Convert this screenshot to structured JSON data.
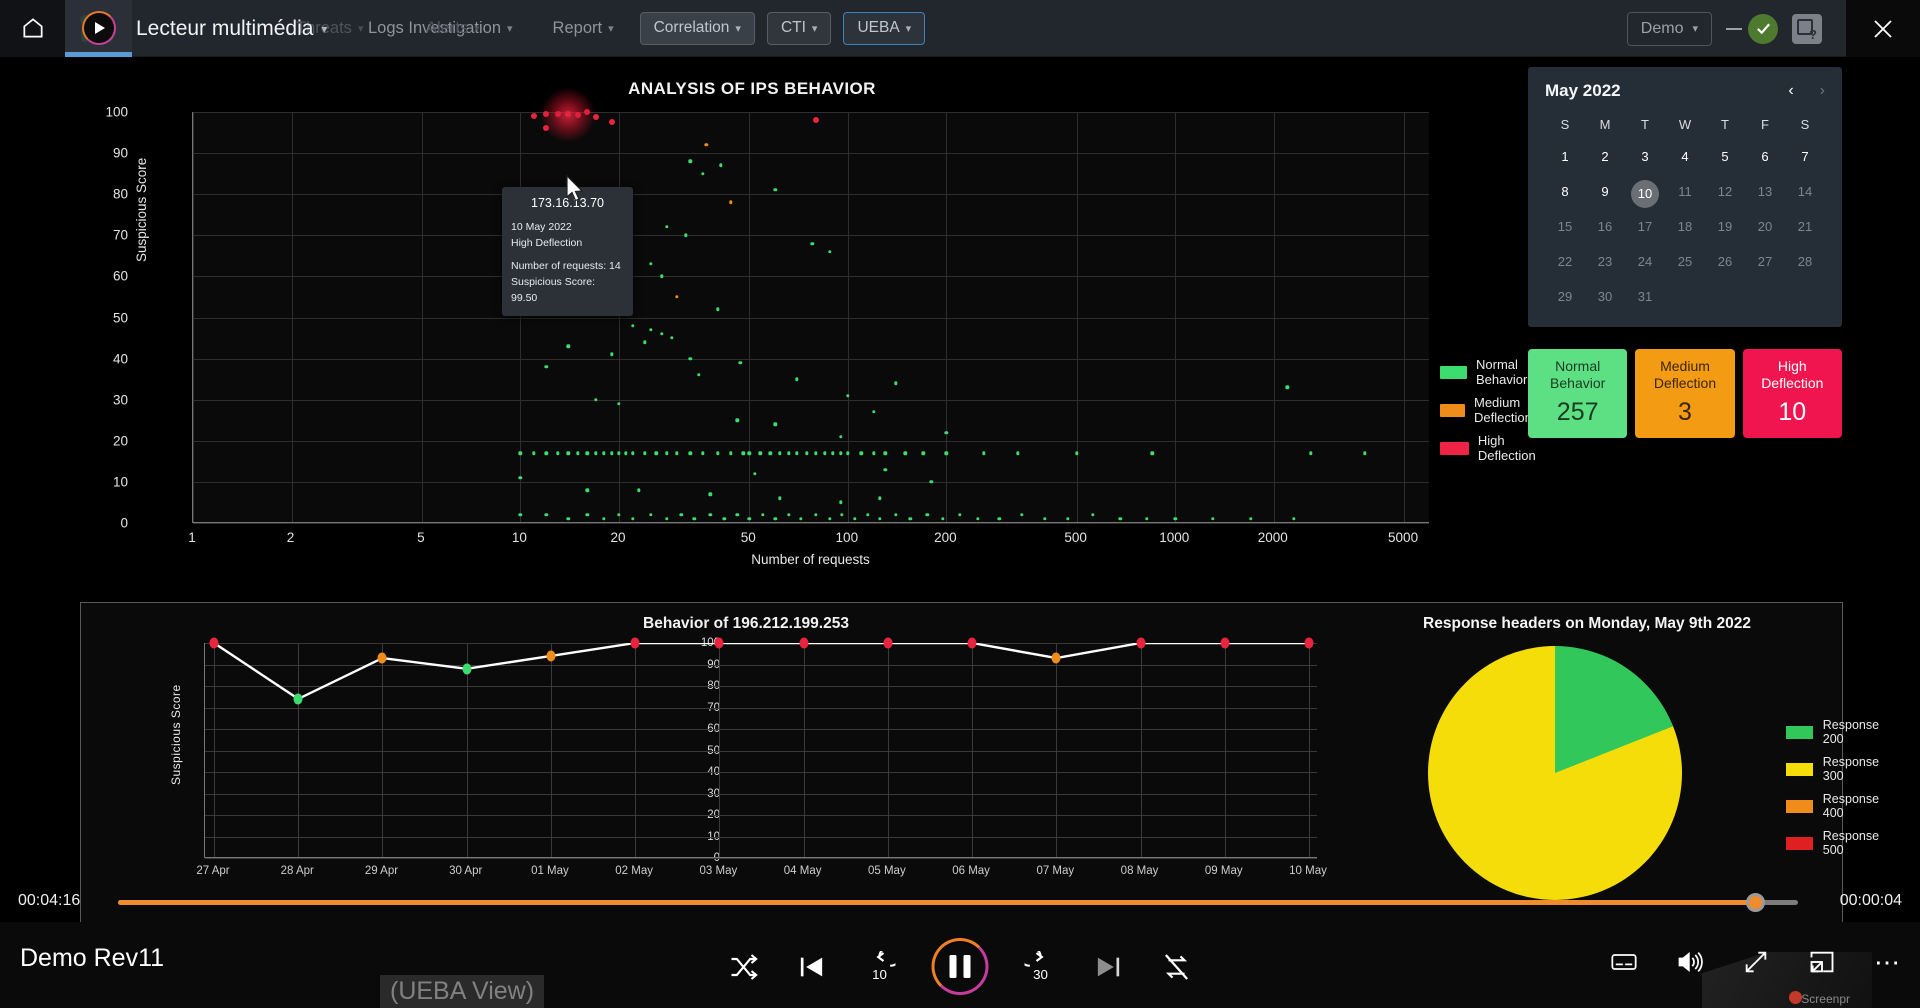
{
  "topnav": {
    "home_icon": "home-icon",
    "logo_icon": "play-logo-icon",
    "ghost_items": [
      "Threats",
      "Alerts"
    ],
    "items": [
      {
        "label": "Logs Investigation",
        "style": "plain-link"
      },
      {
        "label": "Report",
        "style": "plain-link"
      },
      {
        "label": "Correlation",
        "style": "boxed"
      },
      {
        "label": "CTI",
        "style": "boxed-plain"
      },
      {
        "label": "UEBA",
        "style": "boxed-active"
      }
    ],
    "player_title": "Lecteur multimédia",
    "account": "Demo",
    "status_icon": "check-circle-icon",
    "help_icon": "help-window-icon",
    "close_icon": "close-icon"
  },
  "scatter": {
    "title": "ANALYSIS OF IPS BEHAVIOR",
    "legend": [
      {
        "label": "Normal Behavior",
        "color": "#3ddc6e"
      },
      {
        "label": "Medium Deflection",
        "color": "#f08c1a"
      },
      {
        "label": "High Deflection",
        "color": "#e8243f"
      }
    ],
    "tooltip": {
      "ip": "173.16.13.70",
      "date": "10 May 2022",
      "classification": "High Deflection",
      "requests": "Number of requests: 14",
      "score": "Suspicious Score: 99.50"
    }
  },
  "calendar": {
    "title": "May 2022",
    "prev_icon": "chevron-left-icon",
    "next_icon": "chevron-right-icon",
    "dow": [
      "S",
      "M",
      "T",
      "W",
      "T",
      "F",
      "S"
    ],
    "selected_day": 10,
    "last_enabled_day": 10,
    "days": [
      1,
      2,
      3,
      4,
      5,
      6,
      7,
      8,
      9,
      10,
      11,
      12,
      13,
      14,
      15,
      16,
      17,
      18,
      19,
      20,
      21,
      22,
      23,
      24,
      25,
      26,
      27,
      28,
      29,
      30,
      31
    ]
  },
  "cards": [
    {
      "label": "Normal Behavior",
      "value": "257",
      "bg": "#5ce083",
      "fg": "#1b3a22"
    },
    {
      "label": "Medium Deflection",
      "value": "3",
      "bg": "#f29b13",
      "fg": "#3a2505"
    },
    {
      "label": "High Deflection",
      "value": "10",
      "bg": "#f0154e",
      "fg": "#ffffff"
    }
  ],
  "player": {
    "time_elapsed": "00:04:16",
    "time_remaining": "00:00:04",
    "video_title": "Demo Rev11",
    "overlay_badge": "(UEBA View)",
    "watermark": "Screenpr",
    "controls": [
      {
        "name": "shuffle-button",
        "icon": "shuffle-icon"
      },
      {
        "name": "previous-button",
        "icon": "skip-previous-icon"
      },
      {
        "name": "rewind-10-button",
        "icon": "rewind-10-icon",
        "label": "10"
      },
      {
        "name": "pause-button",
        "icon": "pause-icon"
      },
      {
        "name": "forward-30-button",
        "icon": "forward-30-icon",
        "label": "30"
      },
      {
        "name": "next-button",
        "icon": "skip-next-icon"
      },
      {
        "name": "repeat-off-button",
        "icon": "repeat-off-icon"
      }
    ],
    "right_controls": [
      {
        "name": "subtitles-button",
        "icon": "subtitles-icon"
      },
      {
        "name": "volume-button",
        "icon": "volume-high-icon"
      },
      {
        "name": "fullscreen-button",
        "icon": "fullscreen-icon"
      },
      {
        "name": "picture-in-picture-button",
        "icon": "pip-icon"
      },
      {
        "name": "more-options-button",
        "icon": "ellipsis-icon"
      }
    ]
  },
  "chart_data": [
    {
      "type": "scatter",
      "title": "ANALYSIS OF IPS BEHAVIOR",
      "xlabel": "Number of requests",
      "ylabel": "Suspicious Score",
      "xscale": "log",
      "xticks": [
        1,
        2,
        5,
        10,
        20,
        50,
        100,
        200,
        500,
        1000,
        2000,
        5000
      ],
      "yticks": [
        0,
        10,
        20,
        30,
        40,
        50,
        60,
        70,
        80,
        90,
        100
      ],
      "ylim": [
        0,
        100
      ],
      "grid": true,
      "legend_position": "right",
      "series": [
        {
          "name": "High Deflection",
          "color": "#e8243f",
          "points": [
            [
              12,
              99.5
            ],
            [
              13,
              99.5
            ],
            [
              14,
              99.5
            ],
            [
              15,
              99.2
            ],
            [
              11,
              99.0
            ],
            [
              17,
              98.8
            ],
            [
              19,
              97.5
            ],
            [
              80,
              98.0
            ],
            [
              12,
              96.0
            ],
            [
              16,
              100
            ]
          ]
        },
        {
          "name": "Medium Deflection",
          "color": "#f08c1a",
          "points": [
            [
              37,
              92.0
            ],
            [
              44,
              78.0
            ],
            [
              30,
              55.0
            ]
          ]
        },
        {
          "name": "Normal Behavior",
          "color": "#3ddc6e",
          "points": [
            [
              33,
              88
            ],
            [
              41,
              87
            ],
            [
              36,
              85
            ],
            [
              60,
              81
            ],
            [
              28,
              72
            ],
            [
              32,
              70
            ],
            [
              78,
              68
            ],
            [
              88,
              66
            ],
            [
              25,
              63
            ],
            [
              27,
              60
            ],
            [
              17,
              57
            ],
            [
              18,
              55
            ],
            [
              20,
              53
            ],
            [
              40,
              52
            ],
            [
              22,
              48
            ],
            [
              25,
              47
            ],
            [
              27,
              46
            ],
            [
              29,
              45
            ],
            [
              24,
              44
            ],
            [
              14,
              43
            ],
            [
              19,
              41
            ],
            [
              33,
              40
            ],
            [
              47,
              39
            ],
            [
              12,
              38
            ],
            [
              35,
              36
            ],
            [
              70,
              35
            ],
            [
              140,
              34
            ],
            [
              2200,
              33
            ],
            [
              100,
              31
            ],
            [
              17,
              30
            ],
            [
              20,
              29
            ],
            [
              120,
              27
            ],
            [
              46,
              25
            ],
            [
              60,
              24
            ],
            [
              200,
              22
            ],
            [
              95,
              21
            ],
            [
              10,
              17
            ],
            [
              11,
              17
            ],
            [
              12,
              17
            ],
            [
              13,
              17
            ],
            [
              14,
              17
            ],
            [
              15,
              17
            ],
            [
              16,
              17
            ],
            [
              17,
              17
            ],
            [
              18,
              17
            ],
            [
              19,
              17
            ],
            [
              20,
              17
            ],
            [
              21,
              17
            ],
            [
              22,
              17
            ],
            [
              24,
              17
            ],
            [
              26,
              17
            ],
            [
              28,
              17
            ],
            [
              30,
              17
            ],
            [
              33,
              17
            ],
            [
              36,
              17
            ],
            [
              40,
              17
            ],
            [
              44,
              17
            ],
            [
              48,
              17
            ],
            [
              50,
              17
            ],
            [
              54,
              17
            ],
            [
              58,
              17
            ],
            [
              62,
              17
            ],
            [
              66,
              17
            ],
            [
              70,
              17
            ],
            [
              75,
              17
            ],
            [
              80,
              17
            ],
            [
              85,
              17
            ],
            [
              90,
              17
            ],
            [
              95,
              17
            ],
            [
              100,
              17
            ],
            [
              110,
              17
            ],
            [
              120,
              17
            ],
            [
              130,
              17
            ],
            [
              150,
              17
            ],
            [
              170,
              17
            ],
            [
              200,
              17
            ],
            [
              260,
              17
            ],
            [
              330,
              17
            ],
            [
              500,
              17
            ],
            [
              850,
              17
            ],
            [
              2600,
              17
            ],
            [
              3800,
              17
            ],
            [
              10,
              11
            ],
            [
              52,
              12
            ],
            [
              130,
              13
            ],
            [
              180,
              10
            ],
            [
              16,
              8
            ],
            [
              23,
              8
            ],
            [
              38,
              7
            ],
            [
              62,
              6
            ],
            [
              95,
              5
            ],
            [
              125,
              6
            ],
            [
              10,
              2
            ],
            [
              12,
              2
            ],
            [
              14,
              1
            ],
            [
              16,
              2
            ],
            [
              18,
              1
            ],
            [
              20,
              2
            ],
            [
              22,
              1
            ],
            [
              25,
              2
            ],
            [
              28,
              1
            ],
            [
              31,
              2
            ],
            [
              34,
              1
            ],
            [
              38,
              2
            ],
            [
              42,
              1
            ],
            [
              46,
              2
            ],
            [
              50,
              1
            ],
            [
              55,
              2
            ],
            [
              60,
              1
            ],
            [
              66,
              2
            ],
            [
              72,
              1
            ],
            [
              80,
              2
            ],
            [
              88,
              1
            ],
            [
              96,
              2
            ],
            [
              105,
              1
            ],
            [
              115,
              2
            ],
            [
              125,
              1
            ],
            [
              140,
              2
            ],
            [
              155,
              1
            ],
            [
              175,
              2
            ],
            [
              195,
              1
            ],
            [
              220,
              2
            ],
            [
              250,
              1
            ],
            [
              290,
              1
            ],
            [
              340,
              2
            ],
            [
              400,
              1
            ],
            [
              470,
              1
            ],
            [
              560,
              2
            ],
            [
              680,
              1
            ],
            [
              820,
              1
            ],
            [
              1000,
              1
            ],
            [
              1300,
              1
            ],
            [
              1700,
              1
            ],
            [
              2300,
              1
            ]
          ]
        }
      ]
    },
    {
      "type": "line",
      "title": "Behavior of 196.212.199.253",
      "xlabel": "",
      "ylabel": "Suspicious Score",
      "categories": [
        "27 Apr",
        "28 Apr",
        "29 Apr",
        "30 Apr",
        "01 May",
        "02 May",
        "03 May",
        "04 May",
        "05 May",
        "06 May",
        "07 May",
        "08 May",
        "09 May",
        "10 May"
      ],
      "yticks": [
        0,
        10,
        20,
        30,
        40,
        50,
        60,
        70,
        80,
        90,
        100
      ],
      "ylim": [
        0,
        100
      ],
      "grid": true,
      "line_color": "#ffffff",
      "values": [
        100,
        74,
        93,
        88,
        94,
        100,
        100,
        100,
        100,
        100,
        93,
        100,
        100,
        100
      ],
      "point_colors": [
        "#e8243f",
        "#3ddc6e",
        "#f08c1a",
        "#3ddc6e",
        "#f08c1a",
        "#e8243f",
        "#e8243f",
        "#e8243f",
        "#e8243f",
        "#e8243f",
        "#f08c1a",
        "#e8243f",
        "#e8243f",
        "#e8243f"
      ]
    },
    {
      "type": "pie",
      "title": "Response headers on Monday, May 9th 2022",
      "labels": [
        "Response 200",
        "Response 300",
        "Response 400",
        "Response 500"
      ],
      "values": [
        19,
        81,
        0,
        0
      ],
      "colors": [
        "#32c75a",
        "#f5dd0a",
        "#f08c1a",
        "#e02020"
      ],
      "legend_position": "right"
    }
  ]
}
